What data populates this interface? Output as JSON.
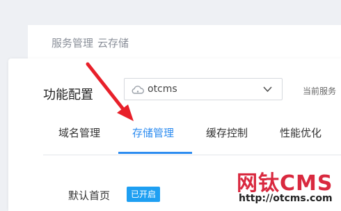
{
  "breadcrumb": {
    "service_management": "服务管理",
    "cloud_storage": "云存储"
  },
  "config": {
    "title": "功能配置"
  },
  "bucket_select": {
    "value": "otcms",
    "icon": "cloud-icon"
  },
  "current_service": {
    "label": "当前服务"
  },
  "tabs": [
    {
      "label": "域名管理",
      "active": false
    },
    {
      "label": "存储管理",
      "active": true
    },
    {
      "label": "缓存控制",
      "active": false
    },
    {
      "label": "性能优化",
      "active": false
    }
  ],
  "setting": {
    "label": "默认首页",
    "status": "已开启"
  },
  "watermark": {
    "brand": "网钛CMS",
    "url": "http://otcms.com"
  },
  "colors": {
    "accent": "#2d8cf0",
    "badge": "#1e9ff2",
    "arrow": "#e8202a",
    "watermark": "#d9293f"
  }
}
